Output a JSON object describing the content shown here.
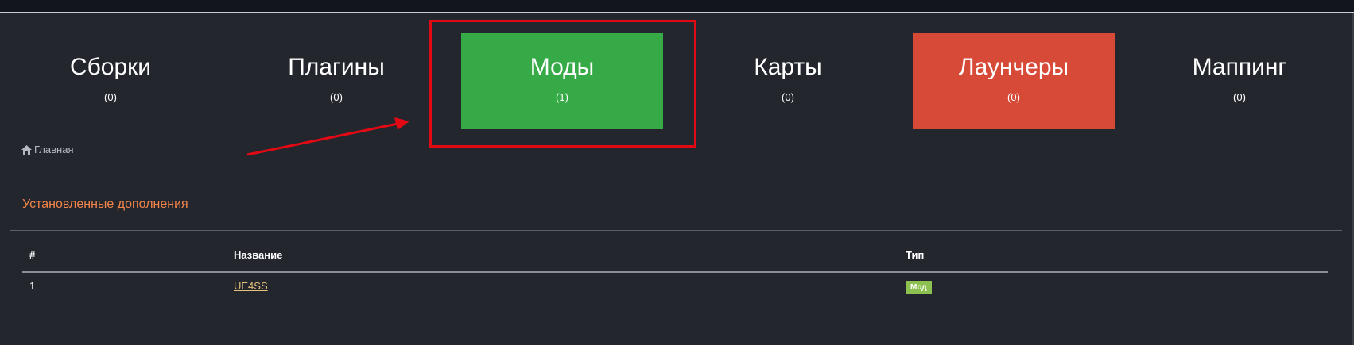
{
  "categories": [
    {
      "label": "Сборки",
      "count": "(0)"
    },
    {
      "label": "Плагины",
      "count": "(0)"
    },
    {
      "label": "Моды",
      "count": "(1)"
    },
    {
      "label": "Карты",
      "count": "(0)"
    },
    {
      "label": "Лаунчеры",
      "count": "(0)"
    },
    {
      "label": "Маппинг",
      "count": "(0)"
    }
  ],
  "breadcrumb": {
    "icon": "home-icon",
    "home_label": "Главная"
  },
  "section": {
    "title": "Установленные дополнения"
  },
  "table": {
    "headers": [
      "#",
      "Название",
      "Тип"
    ],
    "rows": [
      {
        "num": "1",
        "name": "UE4SS",
        "type": "Мод"
      }
    ]
  },
  "colors": {
    "background": "#23262d",
    "active_tile": "#35aa47",
    "launcher_tile": "#d84a38",
    "accent_title": "#f3854a",
    "link": "#e6c27a",
    "badge": "#8cc152",
    "annotation": "#e10a14"
  }
}
